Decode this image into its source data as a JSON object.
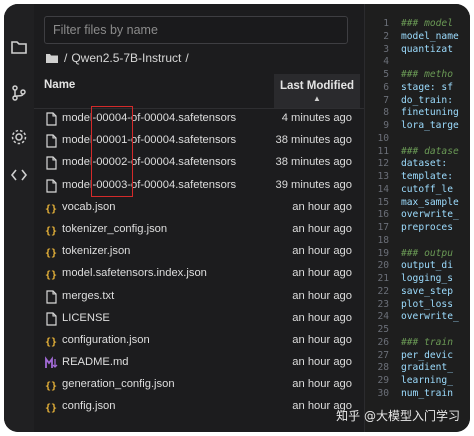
{
  "filter": {
    "placeholder": "Filter files by name"
  },
  "breadcrumb": {
    "root": "/",
    "folder": "Qwen2.5-7B-Instruct",
    "trail": "/"
  },
  "columns": {
    "name": "Name",
    "modified": "Last Modified"
  },
  "files": [
    {
      "name": "model-00004-of-00004.safetensors",
      "modified": "4 minutes ago",
      "icon": "file-icon"
    },
    {
      "name": "model-00001-of-00004.safetensors",
      "modified": "38 minutes ago",
      "icon": "file-icon"
    },
    {
      "name": "model-00002-of-00004.safetensors",
      "modified": "38 minutes ago",
      "icon": "file-icon"
    },
    {
      "name": "model-00003-of-00004.safetensors",
      "modified": "39 minutes ago",
      "icon": "file-icon"
    },
    {
      "name": "vocab.json",
      "modified": "an hour ago",
      "icon": "json-icon"
    },
    {
      "name": "tokenizer_config.json",
      "modified": "an hour ago",
      "icon": "json-icon"
    },
    {
      "name": "tokenizer.json",
      "modified": "an hour ago",
      "icon": "json-icon"
    },
    {
      "name": "model.safetensors.index.json",
      "modified": "an hour ago",
      "icon": "json-icon"
    },
    {
      "name": "merges.txt",
      "modified": "an hour ago",
      "icon": "file-icon"
    },
    {
      "name": "LICENSE",
      "modified": "an hour ago",
      "icon": "file-icon"
    },
    {
      "name": "configuration.json",
      "modified": "an hour ago",
      "icon": "json-icon"
    },
    {
      "name": "README.md",
      "modified": "an hour ago",
      "icon": "markdown-icon"
    },
    {
      "name": "generation_config.json",
      "modified": "an hour ago",
      "icon": "json-icon"
    },
    {
      "name": "config.json",
      "modified": "an hour ago",
      "icon": "json-icon"
    }
  ],
  "editor": {
    "lines": [
      {
        "n": "1",
        "text": "### model",
        "comment": true
      },
      {
        "n": "2",
        "text": "model_name",
        "comment": false
      },
      {
        "n": "3",
        "text": "quantizat",
        "comment": false
      },
      {
        "n": "4",
        "text": "",
        "comment": false
      },
      {
        "n": "5",
        "text": "### metho",
        "comment": true
      },
      {
        "n": "6",
        "text": "stage: sf",
        "comment": false
      },
      {
        "n": "7",
        "text": "do_train:",
        "comment": false
      },
      {
        "n": "8",
        "text": "finetuning",
        "comment": false
      },
      {
        "n": "9",
        "text": "lora_targe",
        "comment": false
      },
      {
        "n": "10",
        "text": "",
        "comment": false
      },
      {
        "n": "11",
        "text": "### datase",
        "comment": true
      },
      {
        "n": "12",
        "text": "dataset:",
        "comment": false
      },
      {
        "n": "13",
        "text": "template:",
        "comment": false
      },
      {
        "n": "14",
        "text": "cutoff_le",
        "comment": false
      },
      {
        "n": "15",
        "text": "max_sample",
        "comment": false
      },
      {
        "n": "16",
        "text": "overwrite_",
        "comment": false
      },
      {
        "n": "17",
        "text": "preproces",
        "comment": false
      },
      {
        "n": "18",
        "text": "",
        "comment": false
      },
      {
        "n": "19",
        "text": "### outpu",
        "comment": true
      },
      {
        "n": "20",
        "text": "output_di",
        "comment": false
      },
      {
        "n": "21",
        "text": "logging_s",
        "comment": false
      },
      {
        "n": "22",
        "text": "save_step",
        "comment": false
      },
      {
        "n": "23",
        "text": "plot_loss",
        "comment": false
      },
      {
        "n": "24",
        "text": "overwrite_",
        "comment": false
      },
      {
        "n": "25",
        "text": "",
        "comment": false
      },
      {
        "n": "26",
        "text": "### train",
        "comment": true
      },
      {
        "n": "27",
        "text": "per_devic",
        "comment": false
      },
      {
        "n": "28",
        "text": "gradient_",
        "comment": false
      },
      {
        "n": "29",
        "text": "learning_",
        "comment": false
      },
      {
        "n": "30",
        "text": "num_train",
        "comment": false
      }
    ]
  },
  "watermark": "知乎 @大模型入门学习",
  "colors": {
    "background": "#1c1c1e",
    "highlight_box": "#d42a2a",
    "json_icon": "#e8b339",
    "markdown_icon": "#a26ad6"
  }
}
